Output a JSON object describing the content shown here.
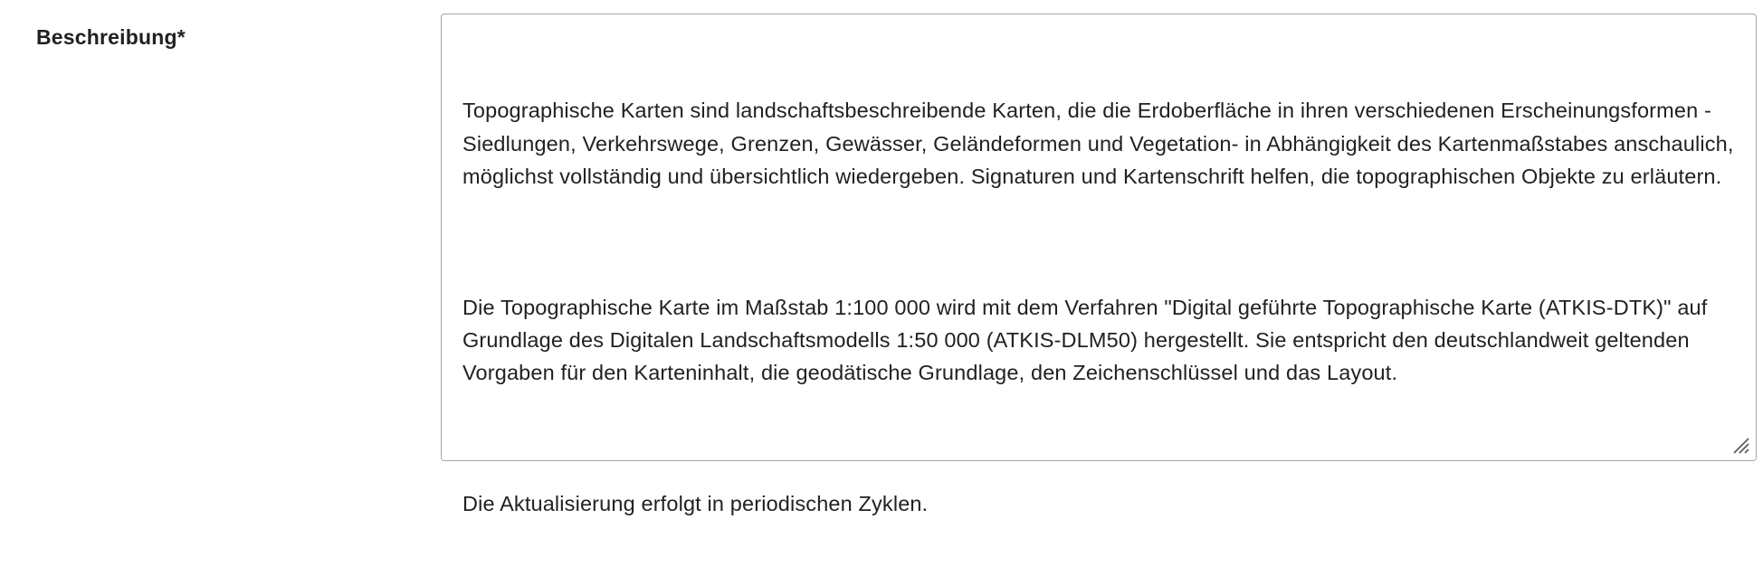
{
  "field": {
    "label": "Beschreibung*",
    "paragraphs": [
      "Topographische Karten sind landschaftsbeschreibende Karten, die die Erdoberfläche in ihren verschiedenen Erscheinungsformen -Siedlungen, Verkehrswege, Grenzen, Gewässer, Geländeformen und Vegetation- in Abhängigkeit des Kartenmaßstabes anschaulich, möglichst vollständig und übersichtlich wiedergeben. Signaturen und Kartenschrift helfen, die topographischen Objekte zu erläutern.",
      "Die Topographische Karte im Maßstab 1:100 000 wird mit dem Verfahren \"Digital geführte Topographische Karte (ATKIS-DTK)\" auf Grundlage des Digitalen Landschaftsmodells 1:50 000 (ATKIS-DLM50) hergestellt. Sie entspricht den deutschlandweit geltenden Vorgaben für den Karteninhalt, die geodätische Grundlage, den Zeichenschlüssel und das Layout.",
      "Die Aktualisierung erfolgt in periodischen Zyklen."
    ],
    "resize_icon": "resize-grip-icon"
  },
  "colors": {
    "text": "#212121",
    "border": "#a6a6a6",
    "background": "#ffffff"
  }
}
